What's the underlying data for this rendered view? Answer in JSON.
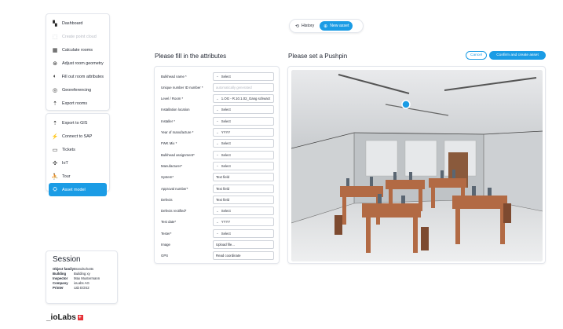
{
  "sidebar": {
    "group1": [
      {
        "label": "Dashboard",
        "icon": "dashboard-icon",
        "state": "normal"
      },
      {
        "label": "Create point cloud",
        "icon": "point-cloud-icon",
        "state": "disabled"
      },
      {
        "label": "Calculate rooms",
        "icon": "calculator-icon",
        "state": "normal"
      },
      {
        "label": "Adjust room geometry",
        "icon": "geometry-icon",
        "state": "normal"
      },
      {
        "label": "Fill out room attributes",
        "icon": "half-circle-icon",
        "state": "normal"
      },
      {
        "label": "Georeferencing",
        "icon": "target-icon",
        "state": "normal"
      },
      {
        "label": "Export rooms",
        "icon": "export-icon",
        "state": "normal"
      }
    ],
    "group2": [
      {
        "label": "Export to GIS",
        "icon": "export-icon",
        "state": "normal"
      },
      {
        "label": "Connect to SAP",
        "icon": "plug-icon",
        "state": "normal"
      },
      {
        "label": "Tickets",
        "icon": "ticket-icon",
        "state": "normal"
      },
      {
        "label": "IoT",
        "icon": "iot-icon",
        "state": "normal"
      },
      {
        "label": "Tour",
        "icon": "walk-icon",
        "state": "normal"
      },
      {
        "label": "Asset model",
        "icon": "asset-icon",
        "state": "active"
      }
    ]
  },
  "toggle": {
    "history_label": "History",
    "new_asset_label": "New asset"
  },
  "form": {
    "title": "Please fill in the attributes",
    "fields": [
      {
        "label": "Bulkhead name *",
        "value": "Select",
        "type": "select"
      },
      {
        "label": "Unique number ID number *",
        "value": "automatically generated",
        "type": "readonly"
      },
      {
        "label": "Level / Room *",
        "value": "1.OG - R.10.1.02_Gang schwarz",
        "type": "select"
      },
      {
        "label": "Installation location",
        "value": "Select",
        "type": "select"
      },
      {
        "label": "Installer *",
        "value": "Select",
        "type": "select"
      },
      {
        "label": "Year of manufacture *",
        "value": "YYYY",
        "type": "select"
      },
      {
        "label": "FWK Mix *",
        "value": "Select",
        "type": "select"
      },
      {
        "label": "Bulkhead assignment*",
        "value": "Select",
        "type": "select"
      },
      {
        "label": "Manufacturer*",
        "value": "Select",
        "type": "select"
      },
      {
        "label": "System*",
        "value": "Text field",
        "type": "text"
      },
      {
        "label": "Approval number*",
        "value": "Text field",
        "type": "text"
      },
      {
        "label": "Defects",
        "value": "Text field",
        "type": "text"
      },
      {
        "label": "Defects rectified*",
        "value": "Select",
        "type": "select"
      },
      {
        "label": "Test date*",
        "value": "YYYY",
        "type": "select"
      },
      {
        "label": "Tester*",
        "value": "Select",
        "type": "select"
      },
      {
        "label": "Image",
        "value": "Upload file...",
        "type": "text"
      },
      {
        "label": "GPS",
        "value": "Read coordinate",
        "type": "text"
      }
    ]
  },
  "viewer": {
    "title": "Please set a Pushpin",
    "cancel_label": "Cancel",
    "confirm_label": "Confirm and create asset"
  },
  "session": {
    "title": "Session",
    "rows": [
      {
        "key": "Object family",
        "value": "Brandschotts"
      },
      {
        "key": "Building",
        "value": "Building xy"
      },
      {
        "key": "Inspector",
        "value": "Max Mustermann"
      },
      {
        "key": "Company",
        "value": "ioLabs AG"
      },
      {
        "key": "Printer",
        "value": "cab EOS2"
      }
    ]
  },
  "logo": {
    "text": "_ioLabs"
  },
  "colors": {
    "accent": "#1b9ce5",
    "logo_red": "#e53238"
  }
}
